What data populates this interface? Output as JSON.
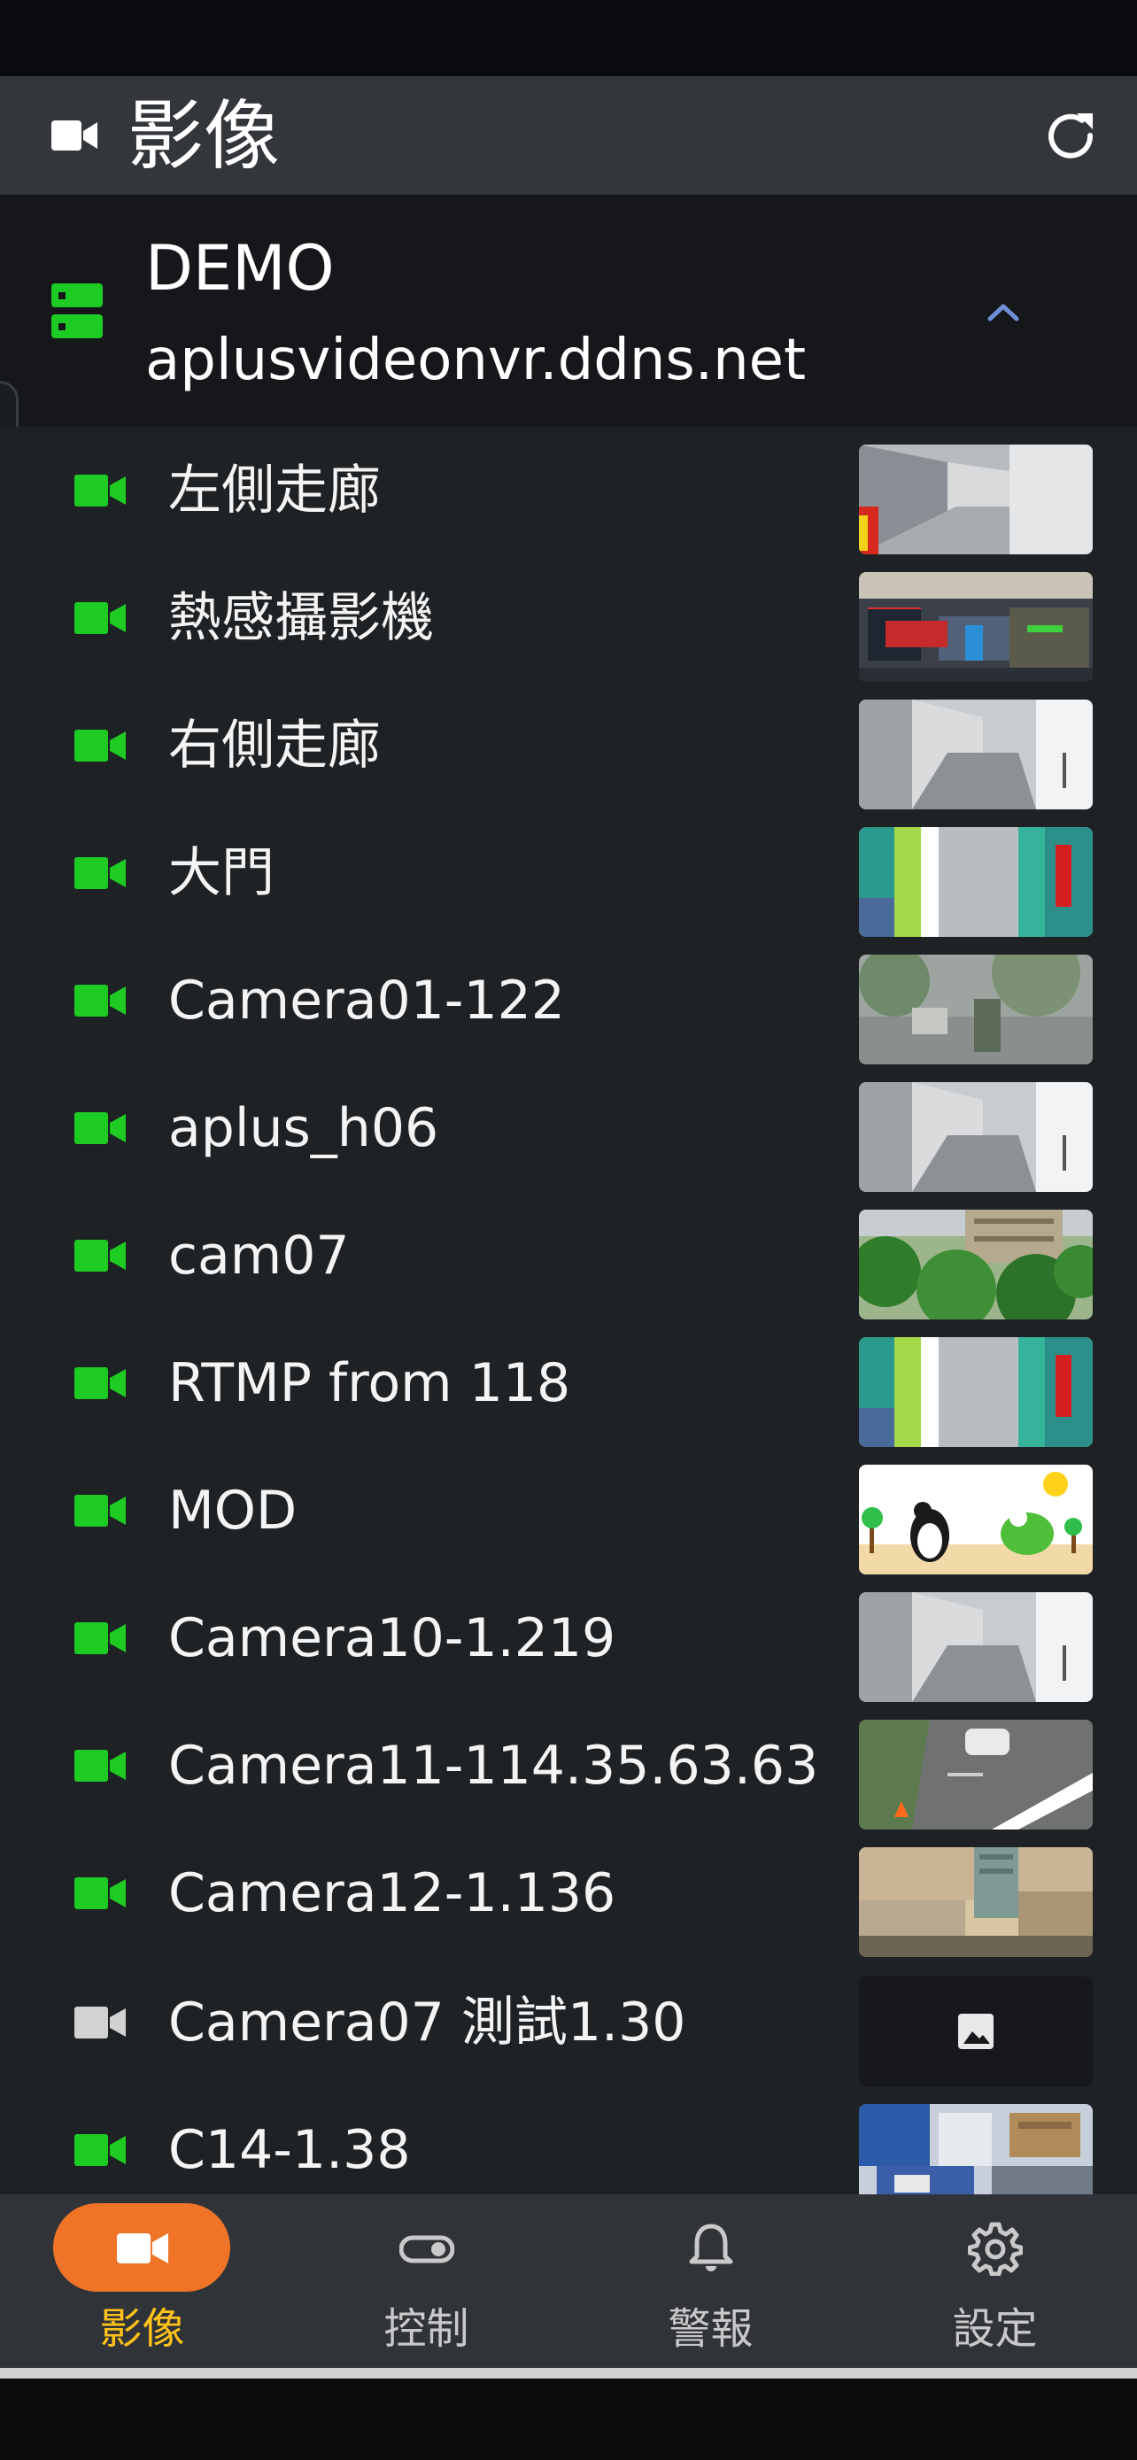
{
  "header": {
    "title": "影像",
    "camera_icon": "video-camera-icon",
    "refresh_icon": "refresh-icon"
  },
  "server": {
    "name": "DEMO",
    "host": "aplusvideonvr.ddns.net",
    "icon": "server-icon",
    "expand_icon": "chevron-up-icon"
  },
  "cameras": [
    {
      "label": "左側走廊",
      "online": true,
      "thumbnail": "hallway"
    },
    {
      "label": "熱感攝影機",
      "online": true,
      "thumbnail": "thermal"
    },
    {
      "label": "右側走廊",
      "online": true,
      "thumbnail": "corridor"
    },
    {
      "label": "大門",
      "online": true,
      "thumbnail": "door"
    },
    {
      "label": "Camera01-122",
      "online": true,
      "thumbnail": "street"
    },
    {
      "label": "aplus_h06",
      "online": true,
      "thumbnail": "corridor"
    },
    {
      "label": "cam07",
      "online": true,
      "thumbnail": "trees"
    },
    {
      "label": "RTMP from 118",
      "online": true,
      "thumbnail": "door"
    },
    {
      "label": "MOD",
      "online": true,
      "thumbnail": "cartoon"
    },
    {
      "label": "Camera10-1.219",
      "online": true,
      "thumbnail": "corridor"
    },
    {
      "label": "Camera11-114.35.63.63",
      "online": true,
      "thumbnail": "road"
    },
    {
      "label": "Camera12-1.136",
      "online": true,
      "thumbnail": "building"
    },
    {
      "label": "Camera07 測試1.30",
      "online": false,
      "thumbnail": "image-placeholder-icon"
    },
    {
      "label": "C14-1.38",
      "online": true,
      "thumbnail": "office"
    }
  ],
  "colors": {
    "online": "#1ecb23",
    "offline": "#d2d2d2",
    "accent": "#ef7427",
    "active_label": "#ffc21a"
  },
  "bottom_nav": [
    {
      "label": "影像",
      "icon": "video-camera-icon",
      "active": true
    },
    {
      "label": "控制",
      "icon": "toggle-icon",
      "active": false
    },
    {
      "label": "警報",
      "icon": "bell-icon",
      "active": false
    },
    {
      "label": "設定",
      "icon": "gear-icon",
      "active": false
    }
  ]
}
